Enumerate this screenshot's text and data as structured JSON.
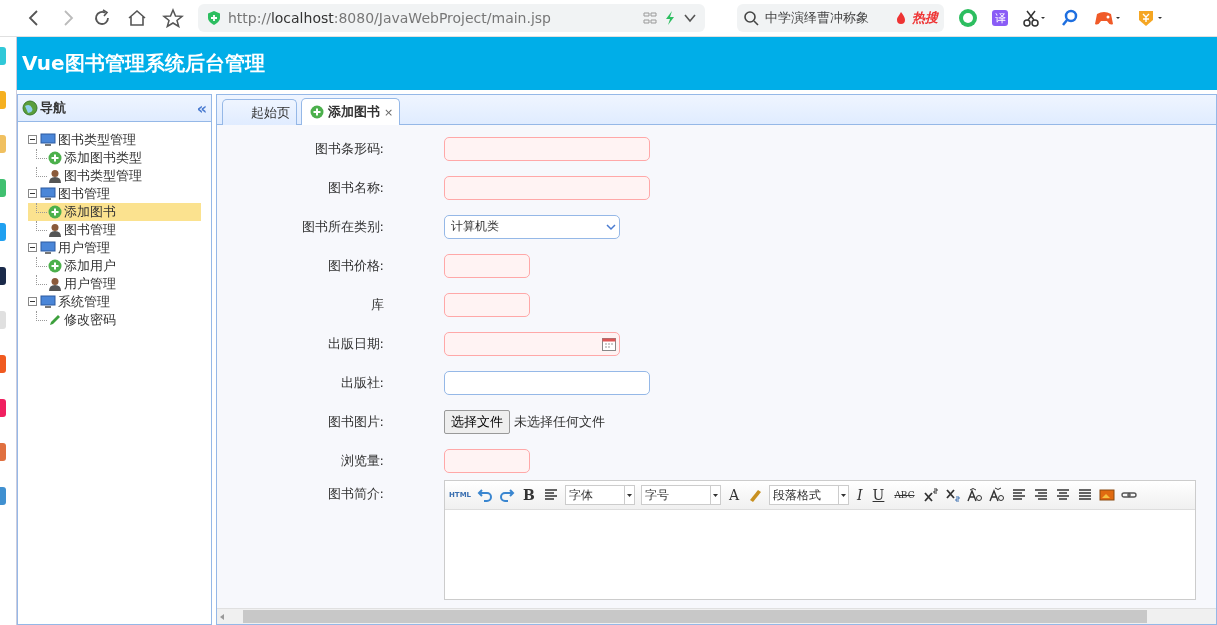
{
  "browser": {
    "url_scheme": "http://",
    "url_host": "localhost",
    "url_rest": ":8080/JavaWebProject/main.jsp",
    "search_text": "中学演绎曹冲称象",
    "hot_label": "热搜",
    "translate_label": "译"
  },
  "header": {
    "title": "Vue图书管理系统后台管理"
  },
  "sidebar": {
    "title": "导航",
    "collapse": "«",
    "tree": [
      {
        "label": "图书类型管理",
        "expanded": true,
        "children": [
          {
            "label": "添加图书类型",
            "kind": "add",
            "selected": false
          },
          {
            "label": "图书类型管理",
            "kind": "manage",
            "selected": false
          }
        ]
      },
      {
        "label": "图书管理",
        "expanded": true,
        "children": [
          {
            "label": "添加图书",
            "kind": "add",
            "selected": true
          },
          {
            "label": "图书管理",
            "kind": "manage",
            "selected": false
          }
        ]
      },
      {
        "label": "用户管理",
        "expanded": true,
        "children": [
          {
            "label": "添加用户",
            "kind": "add",
            "selected": false
          },
          {
            "label": "用户管理",
            "kind": "manage",
            "selected": false
          }
        ]
      },
      {
        "label": "系统管理",
        "expanded": true,
        "children": [
          {
            "label": "修改密码",
            "kind": "edit",
            "selected": false
          }
        ]
      }
    ]
  },
  "tabs": [
    {
      "label": "起始页",
      "selected": false
    },
    {
      "label": "添加图书",
      "selected": true,
      "close": "×"
    }
  ],
  "form": {
    "fields": [
      {
        "label": "图书条形码:",
        "kind": "text",
        "short": false,
        "invalid": true
      },
      {
        "label": "图书名称:",
        "kind": "text",
        "short": false,
        "invalid": true
      },
      {
        "label": "图书所在类别:",
        "kind": "select",
        "value": "计算机类"
      },
      {
        "label": "图书价格:",
        "kind": "text",
        "short": true,
        "invalid": true
      },
      {
        "label": "库",
        "kind": "text",
        "short": true,
        "invalid": true
      },
      {
        "label": "出版日期:",
        "kind": "date",
        "invalid": true
      },
      {
        "label": "出版社:",
        "kind": "text",
        "short": false,
        "invalid": false
      },
      {
        "label": "图书图片:",
        "kind": "file",
        "button": "选择文件",
        "status": "未选择任何文件"
      },
      {
        "label": "浏览量:",
        "kind": "text",
        "short": true,
        "invalid": true
      },
      {
        "label": "图书简介:",
        "kind": "editor",
        "html_label": "HTML",
        "bold": "B",
        "font": "字体",
        "size_select": "字号",
        "color_label": "A",
        "format": "段落格式",
        "italic": "I",
        "underline": "U",
        "strike": "ABC"
      }
    ]
  }
}
